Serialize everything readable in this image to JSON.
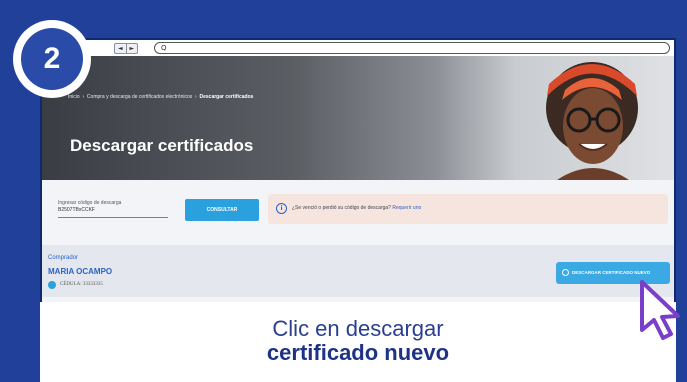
{
  "step": {
    "number": "2"
  },
  "browser": {
    "nav_back": "◄",
    "nav_forward": "►",
    "search_glyph": "Q"
  },
  "hero": {
    "breadcrumb_home": "Inicio",
    "breadcrumb_mid": "Compra y descarga de certificados electrónicos",
    "breadcrumb_current": "Descargar certificados",
    "title": "Descargar certificados"
  },
  "lookup": {
    "code_label": "Ingresar código de descarga",
    "code_value": "B2507TBxCCKF",
    "consult_label": "CONSULTAR",
    "notice_text": "¿Se venció o perdió su código de descarga?",
    "notice_link": "Requerir uno"
  },
  "buyer": {
    "label": "Comprador",
    "name": "MARIA OCAMPO",
    "id": "CÉDULA: 33333335"
  },
  "actions": {
    "new_certificate": "DESCARGAR CERTIFICADO NUEVO"
  },
  "caption": {
    "line1": "Clic en descargar",
    "line2": "certificado nuevo"
  },
  "colors": {
    "background": "#21409a",
    "accent": "#2aa0de",
    "caption_text": "#1f3386",
    "cursor": "#7a3fc8"
  }
}
